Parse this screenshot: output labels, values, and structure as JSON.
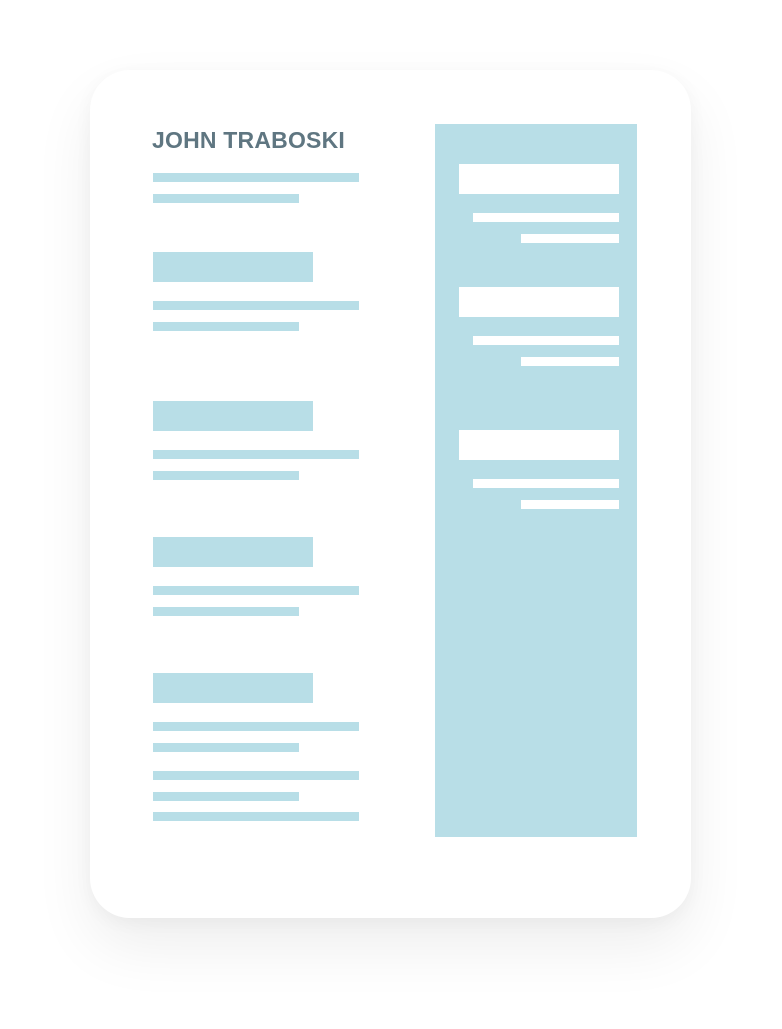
{
  "resume": {
    "name": "JOHN TRABOSKI"
  },
  "colors": {
    "name_text": "#5f7681",
    "placeholder_block": "#b8dee7",
    "sidebar_background": "#b8dee7",
    "sidebar_block": "#ffffff",
    "card_background": "#ffffff"
  }
}
